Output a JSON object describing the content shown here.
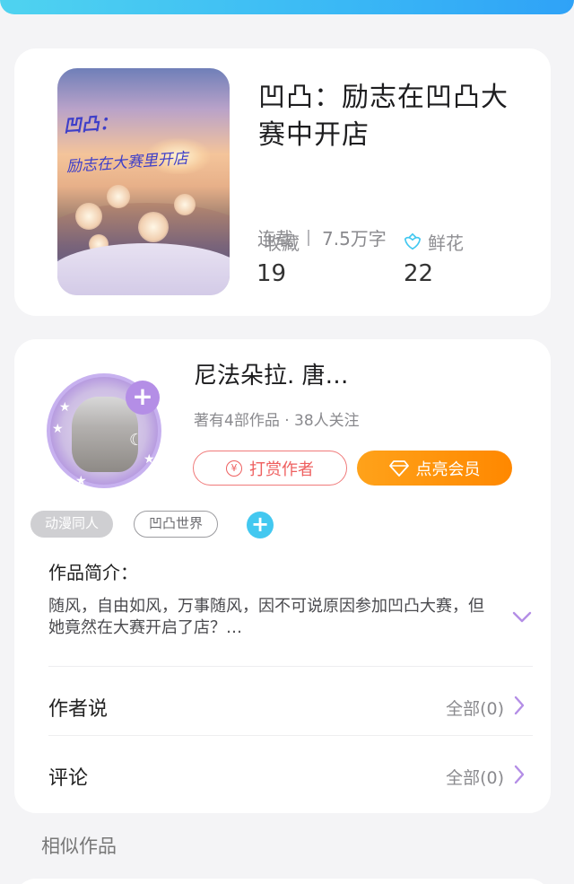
{
  "book": {
    "cover_title_line1": "凹凸：",
    "cover_title_line2": "励志在大赛里开店",
    "title": "凹凸：励志在凹凸大赛中开店",
    "status": "连载",
    "word_count": "7.5万字",
    "favorites_label": "收藏",
    "favorites_count": "19",
    "flowers_label": "鲜花",
    "flowers_count": "22"
  },
  "author": {
    "name": "尼法朵拉. 唐…",
    "meta": "著有4部作品 · 38人关注",
    "tip_label": "打赏作者",
    "vip_label": "点亮会员"
  },
  "tags": [
    "动漫同人",
    "凹凸世界"
  ],
  "intro": {
    "heading": "作品简介：",
    "text": "随风，自由如风，万事随风，因不可说原因参加凹凸大赛，但她竟然在大赛开启了店？…"
  },
  "author_says": {
    "label": "作者说",
    "link": "全部(0)"
  },
  "comments": {
    "label": "评论",
    "link": "全部(0)"
  },
  "similar_heading": "相似作品",
  "colors": {
    "accent_blue": "#43c8f0",
    "vip_orange": "#ff8800",
    "tip_red": "#ee5f5f",
    "purple": "#b48ee6"
  }
}
